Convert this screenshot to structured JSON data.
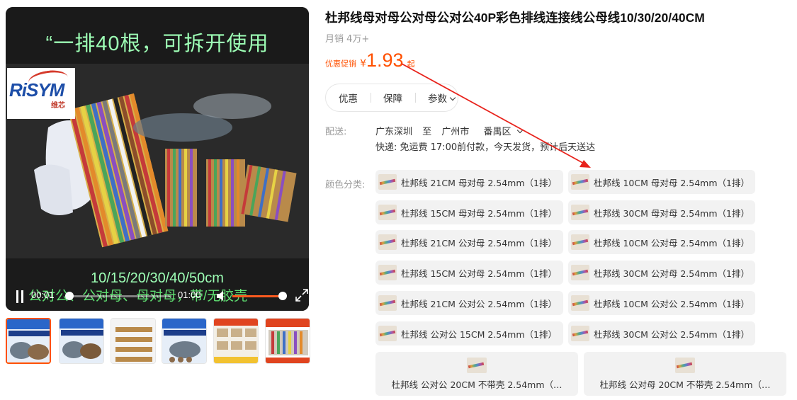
{
  "video": {
    "caption_top": "“一排40根，可拆开使用",
    "caption_mid": "10/15/20/30/40/50cm",
    "caption_bottom": "公对公、公对母、母对母，带/无胶壳",
    "logo_text": "RiSYM",
    "logo_sub": "维芯",
    "time_current": "00:01",
    "time_total": "01:00",
    "progress_fraction": 0.0,
    "volume_fraction": 0.95
  },
  "thumbnails": [
    {
      "name": "thumb-1",
      "active": true
    },
    {
      "name": "thumb-2",
      "active": false
    },
    {
      "name": "thumb-3",
      "active": false
    },
    {
      "name": "thumb-4",
      "active": false
    },
    {
      "name": "thumb-5",
      "active": false
    },
    {
      "name": "thumb-6",
      "active": false
    }
  ],
  "product": {
    "title": "杜邦线母对母公对母公对公40P彩色排线连接线公母线10/30/20/40CM",
    "sales": "月销 4万+",
    "price_label": "优惠促销",
    "price_symbol": "¥",
    "price_value": "1.93",
    "price_suffix": "起"
  },
  "tabs": {
    "discount": "优惠",
    "guarantee": "保障",
    "params": "参数"
  },
  "shipping": {
    "label": "配送:",
    "from": "广东深圳",
    "to_word": "至",
    "city": "广州市",
    "district": "番禺区",
    "express": "快递: 免运费   17:00前付款，今天发货，预计后天送达"
  },
  "colors": {
    "label": "颜色分类:",
    "options": [
      "杜邦线 21CM 母对母 2.54mm（1排）",
      "杜邦线 10CM 母对母 2.54mm（1排）",
      "杜邦线 15CM 母对母 2.54mm（1排）",
      "杜邦线 30CM 母对母 2.54mm（1排）",
      "杜邦线 21CM 公对母 2.54mm（1排）",
      "杜邦线 10CM 公对母 2.54mm（1排）",
      "杜邦线 15CM 公对母 2.54mm（1排）",
      "杜邦线 30CM 公对母 2.54mm（1排）",
      "杜邦线 21CM 公对公 2.54mm（1排）",
      "杜邦线 10CM 公对公 2.54mm（1排）",
      "杜邦线 公对公 15CM 2.54mm（1排）",
      "杜邦线 30CM 公对公 2.54mm（1排）",
      "杜邦线 公对公 20CM 不带壳 2.54mm（…",
      "杜邦线 公对母 20CM 不带壳 2.54mm（…"
    ]
  },
  "annotation": {
    "color": "#e8231c"
  },
  "accent": "#ff5000"
}
